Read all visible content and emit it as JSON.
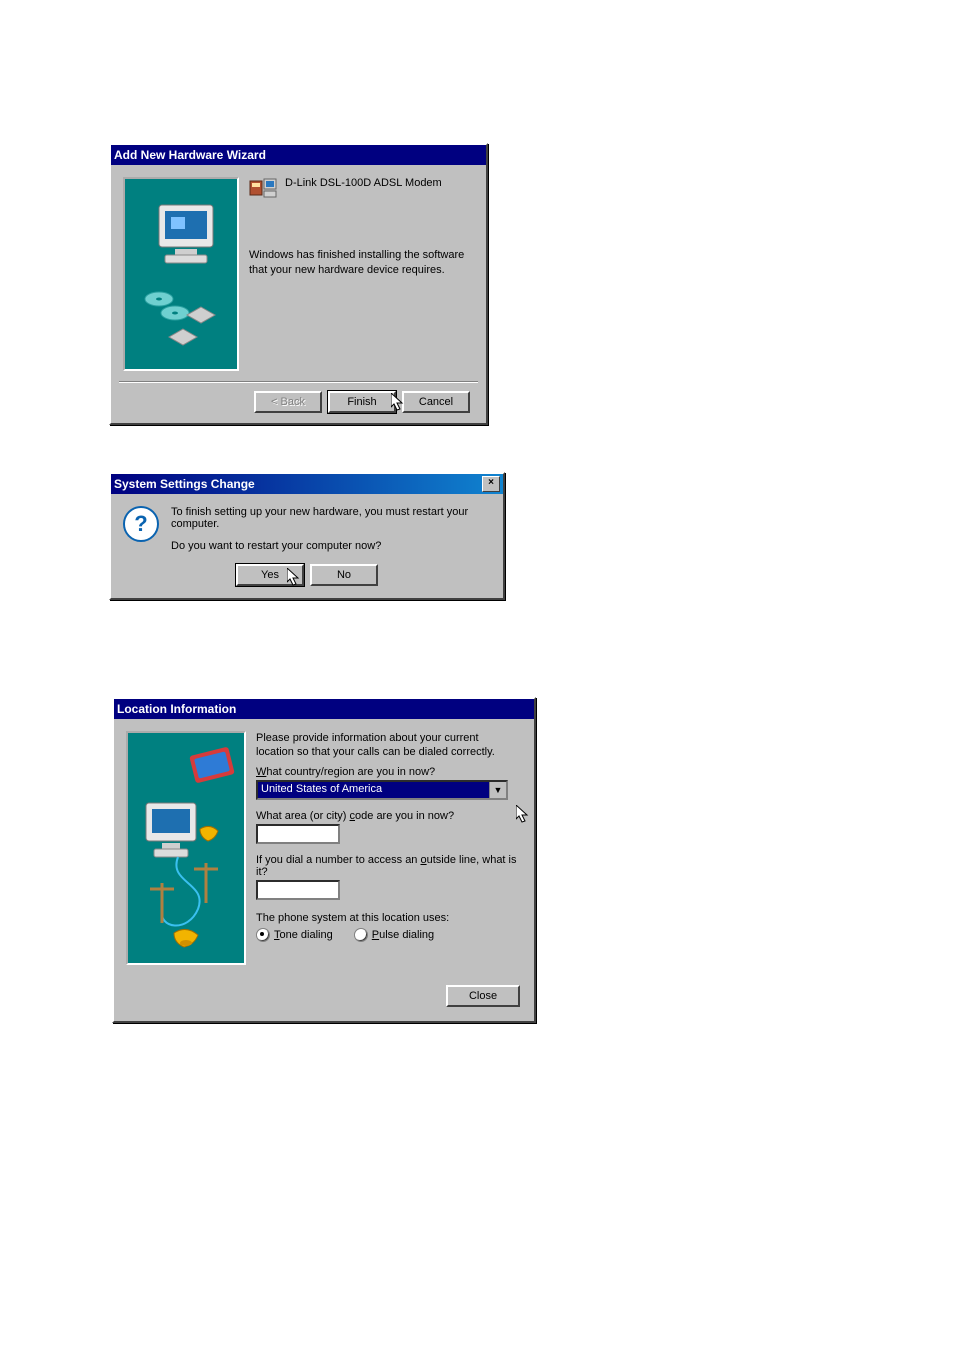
{
  "wizard": {
    "title": "Add New Hardware Wizard",
    "device_name": "D-Link DSL-100D ADSL Modem",
    "message": "Windows has finished installing the software that your new hardware device requires.",
    "buttons": {
      "back": "< Back",
      "finish": "Finish",
      "cancel": "Cancel"
    }
  },
  "restart": {
    "title": "System Settings Change",
    "line1": "To finish setting up your new hardware, you must restart your computer.",
    "line2": "Do you want to restart your computer now?",
    "buttons": {
      "yes": "Yes",
      "no": "No"
    }
  },
  "location": {
    "title": "Location Information",
    "intro": "Please provide information about your current location so that your calls can be dialed correctly.",
    "q_country": "What country/region are you in now?",
    "country_value": "United States of America",
    "q_area": "What area (or city) code are you in now?",
    "area_value": "",
    "q_outside": "If you dial a number to access an outside line, what is it?",
    "outside_value": "",
    "phone_system_label": "The phone system at this location uses:",
    "radio_tone": "Tone dialing",
    "radio_pulse": "Pulse dialing",
    "close": "Close"
  }
}
